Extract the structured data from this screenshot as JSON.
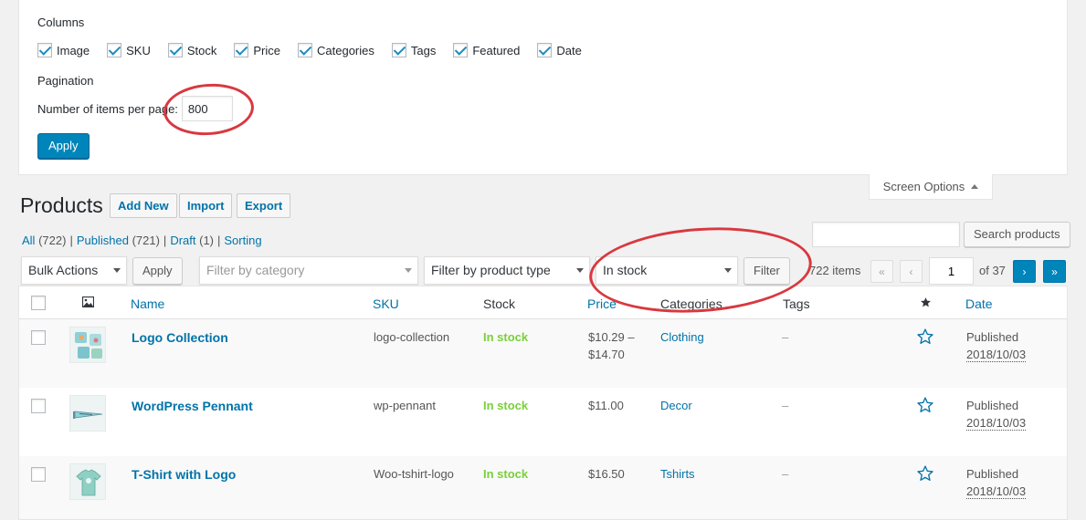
{
  "screen_options": {
    "columns_heading": "Columns",
    "columns": [
      {
        "label": "Image",
        "checked": true
      },
      {
        "label": "SKU",
        "checked": true
      },
      {
        "label": "Stock",
        "checked": true
      },
      {
        "label": "Price",
        "checked": true
      },
      {
        "label": "Categories",
        "checked": true
      },
      {
        "label": "Tags",
        "checked": true
      },
      {
        "label": "Featured",
        "checked": true
      },
      {
        "label": "Date",
        "checked": true
      }
    ],
    "pagination_heading": "Pagination",
    "per_page_label": "Number of items per page:",
    "per_page_value": "800",
    "apply_label": "Apply",
    "tab_label": "Screen Options"
  },
  "header": {
    "title": "Products",
    "add_new": "Add New",
    "import": "Import",
    "export": "Export"
  },
  "views": [
    {
      "label": "All",
      "count": "(722)",
      "current": false
    },
    {
      "label": "Published",
      "count": "(721)",
      "current": false
    },
    {
      "label": "Draft",
      "count": "(1)",
      "current": false
    },
    {
      "label": "Sorting",
      "count": "",
      "current": false
    }
  ],
  "search": {
    "button_label": "Search products",
    "value": ""
  },
  "filters": {
    "bulk_actions": "Bulk Actions",
    "bulk_apply": "Apply",
    "category_placeholder": "Filter by category",
    "product_type": "Filter by product type",
    "stock_status": "In stock",
    "filter_button": "Filter"
  },
  "pagination": {
    "items_text": "722 items",
    "first": "«",
    "prev": "‹",
    "current_page": "1",
    "of_text": "of 37",
    "next": "›",
    "last": "»"
  },
  "table": {
    "columns": {
      "image_icon": "image-icon",
      "name": "Name",
      "sku": "SKU",
      "stock": "Stock",
      "price": "Price",
      "categories": "Categories",
      "tags": "Tags",
      "featured_icon": "star-icon",
      "date": "Date"
    },
    "rows": [
      {
        "name": "Logo Collection",
        "sku": "logo-collection",
        "stock": "In stock",
        "price_line1": "$10.29 –",
        "price_line2": "$14.70",
        "category": "Clothing",
        "tags": "–",
        "status": "Published",
        "date": "2018/10/03"
      },
      {
        "name": "WordPress Pennant",
        "sku": "wp-pennant",
        "stock": "In stock",
        "price_line1": "$11.00",
        "price_line2": "",
        "category": "Decor",
        "tags": "–",
        "status": "Published",
        "date": "2018/10/03"
      },
      {
        "name": "T-Shirt with Logo",
        "sku": "Woo-tshirt-logo",
        "stock": "In stock",
        "price_line1": "$16.50",
        "price_line2": "",
        "category": "Tshirts",
        "tags": "–",
        "status": "Published",
        "date": "2018/10/03"
      }
    ]
  },
  "colors": {
    "primary": "#0085ba",
    "link": "#0073aa",
    "in_stock": "#7ad03a",
    "annotation": "#d9383f"
  }
}
